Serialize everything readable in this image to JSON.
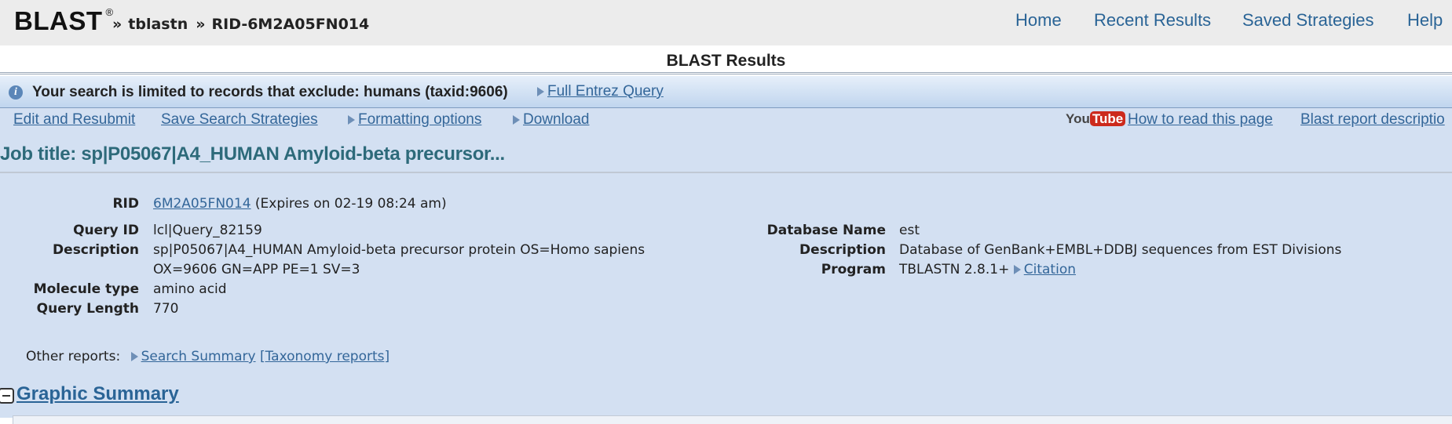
{
  "header": {
    "logo": "BLAST",
    "logo_reg": "®",
    "crumb_sep": "»",
    "crumb_program": "tblastn",
    "crumb_rid": "RID-6M2A05FN014",
    "nav": [
      "Home",
      "Recent Results",
      "Saved Strategies",
      "Help"
    ]
  },
  "results_title": "BLAST Results",
  "notice": {
    "text": "Your search is limited to records that exclude: humans (taxid:9606)",
    "link": "Full Entrez Query",
    "icon": "info-icon"
  },
  "toolbar": {
    "edit": "Edit and Resubmit",
    "save": "Save Search Strategies",
    "formatting": "Formatting options",
    "download": "Download",
    "youtube_you": "You",
    "youtube_tube": "Tube",
    "how_to_read": "How to read this page",
    "report_desc": "Blast report descriptio"
  },
  "job_title": "Job title: sp|P05067|A4_HUMAN Amyloid-beta precursor...",
  "details": {
    "rid_label": "RID",
    "rid_value": "6M2A05FN014",
    "rid_expires": "(Expires on 02-19 08:24 am)",
    "query_id_label": "Query ID",
    "query_id": "lcl|Query_82159",
    "description_label": "Description",
    "description_line1": "sp|P05067|A4_HUMAN Amyloid-beta precursor protein OS=Homo sapiens",
    "description_line2": "OX=9606 GN=APP PE=1 SV=3",
    "molecule_type_label": "Molecule type",
    "molecule_type": "amino acid",
    "query_length_label": "Query Length",
    "query_length": "770",
    "database_name_label": "Database Name",
    "database_name": "est",
    "db_description_label": "Description",
    "db_description": "Database of GenBank+EMBL+DDBJ sequences from EST Divisions",
    "program_label": "Program",
    "program": "TBLASTN 2.8.1+",
    "citation": "Citation"
  },
  "other_reports": {
    "label": "Other reports:",
    "search_summary": "Search Summary",
    "taxonomy": "[Taxonomy reports]"
  },
  "graphic_summary": "Graphic Summary"
}
